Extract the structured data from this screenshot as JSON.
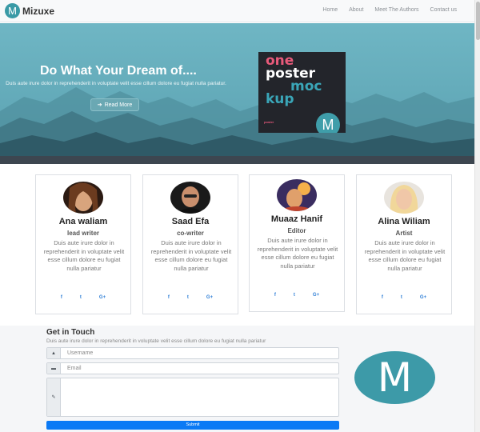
{
  "brand": {
    "logo_letter": "M",
    "name": "Mizuxe"
  },
  "nav": {
    "items": [
      "Home",
      "About",
      "Meet The Authors",
      "Contact us"
    ]
  },
  "hero": {
    "title": "Do What Your Dream of....",
    "text": "Duis aute irure dolor in reprehenderit in voluptate velit esse cillum dolore eu fugiat nulla pariatur.",
    "button_label": "Read More",
    "button_icon": "arrow-right-circle-icon",
    "poster": {
      "lines": [
        "one",
        "poster",
        "moc",
        "kup"
      ],
      "colors": [
        "#e85a7a",
        "#ffffff",
        "#3aa6b8",
        "#3aa6b8"
      ],
      "logo_letter": "M",
      "small_text": "poster"
    }
  },
  "authors": [
    {
      "name": "Ana waliam",
      "role": "lead writer",
      "bio": "Duis aute irure dolor in reprehenderit in voluptate velit esse cillum dolore eu fugiat nulla pariatur",
      "social": [
        "f",
        "t",
        "G+"
      ]
    },
    {
      "name": "Saad Efa",
      "role": "co-writer",
      "bio": "Duis aute irure dolor in reprehenderit in voluptate velit esse cillum dolore eu fugiat nulla pariatur",
      "social": [
        "f",
        "t",
        "G+"
      ]
    },
    {
      "name": "Muaaz Hanif",
      "role": "Editor",
      "bio": "Duis aute irure dolor in reprehenderit in voluptate velit esse cillum dolore eu fugiat nulla pariatur",
      "social": [
        "f",
        "t",
        "G+"
      ]
    },
    {
      "name": "Alina Wiliam",
      "role": "Artist",
      "bio": "Duis aute irure dolor in reprehenderit in voluptate velit esse cillum dolore eu fugiat nulla pariatur",
      "social": [
        "f",
        "t",
        "G+"
      ]
    }
  ],
  "contact": {
    "title": "Get in Touch",
    "subtitle": "Duis aute irure dolor in reprehenderit in voluptate velit esse cillum dolore eu fugiat nulla pariatur",
    "username_placeholder": "Username",
    "email_placeholder": "Email",
    "submit_label": "Submit",
    "logo_letter": "M"
  },
  "colors": {
    "accent": "#3d9aa8",
    "submit": "#0b7af5",
    "social": "#2f7fd6"
  }
}
